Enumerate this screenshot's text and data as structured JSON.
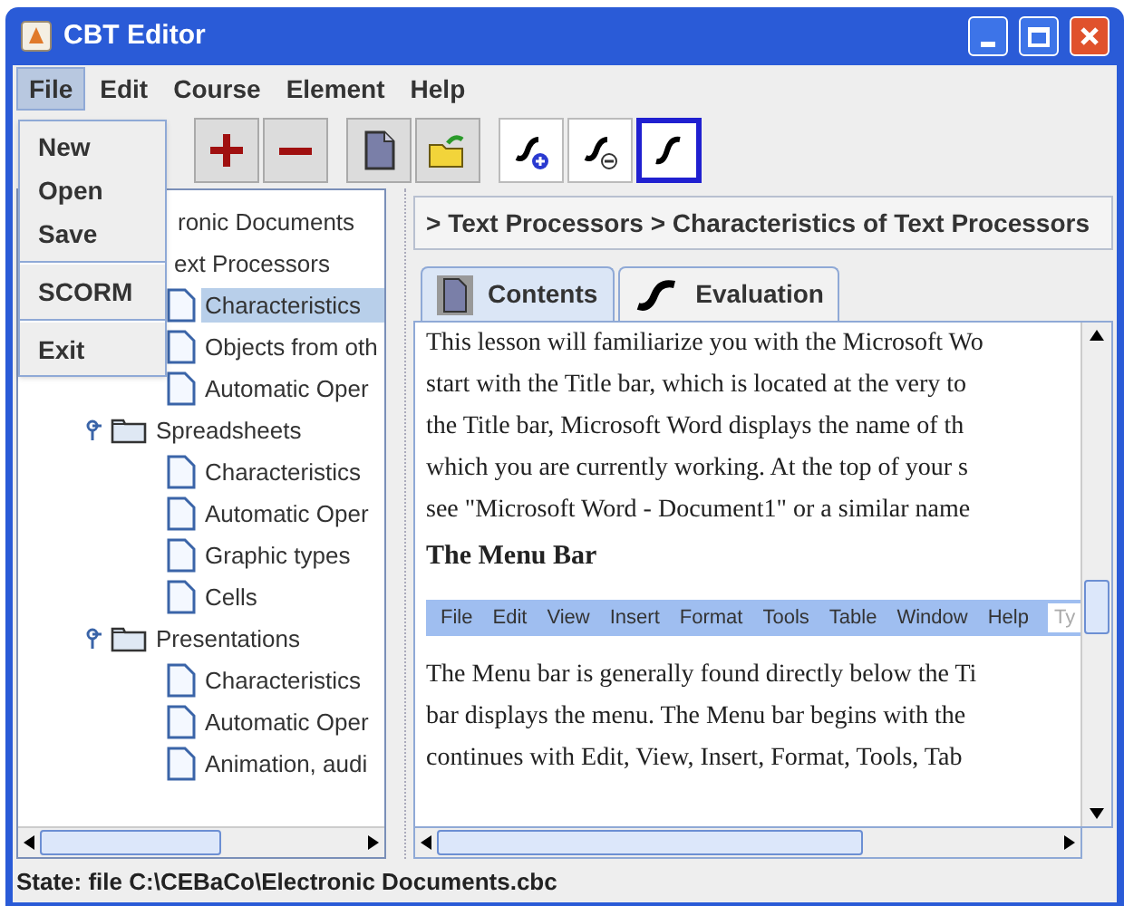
{
  "window": {
    "title": "CBT Editor"
  },
  "menu_bar": [
    {
      "label": "File",
      "selected": true
    },
    {
      "label": "Edit",
      "selected": false
    },
    {
      "label": "Course",
      "selected": false
    },
    {
      "label": "Element",
      "selected": false
    },
    {
      "label": "Help",
      "selected": false
    }
  ],
  "file_menu": [
    {
      "kind": "item",
      "label": "New"
    },
    {
      "kind": "item",
      "label": "Open"
    },
    {
      "kind": "item",
      "label": "Save"
    },
    {
      "kind": "separator"
    },
    {
      "kind": "item",
      "label": "SCORM"
    },
    {
      "kind": "separator"
    },
    {
      "kind": "item",
      "label": "Exit"
    }
  ],
  "toolbar": [
    {
      "kind": "add",
      "selected": false
    },
    {
      "kind": "remove",
      "selected": false
    },
    {
      "kind": "page",
      "selected": false
    },
    {
      "kind": "open",
      "selected": false
    },
    {
      "kind": "eval-add",
      "selected": false
    },
    {
      "kind": "eval-remove",
      "selected": false
    },
    {
      "kind": "eval",
      "selected": true
    }
  ],
  "tree": [
    {
      "kind": "clipped",
      "label": "ronic Documents",
      "selected": false,
      "children": [
        {
          "kind": "clipped",
          "label": "ext Processors",
          "selected": false,
          "children": [
            {
              "kind": "page",
              "label": "Characteristics",
              "selected": true
            },
            {
              "kind": "page",
              "label": "Objects from oth",
              "selected": false
            },
            {
              "kind": "page",
              "label": "Automatic Oper",
              "selected": false
            }
          ]
        },
        {
          "kind": "folder",
          "label": "Spreadsheets",
          "selected": false,
          "children": [
            {
              "kind": "page",
              "label": "Characteristics",
              "selected": false
            },
            {
              "kind": "page",
              "label": "Automatic Oper",
              "selected": false
            },
            {
              "kind": "page",
              "label": "Graphic types",
              "selected": false
            },
            {
              "kind": "page",
              "label": "Cells",
              "selected": false
            }
          ]
        },
        {
          "kind": "folder",
          "label": "Presentations",
          "selected": false,
          "children": [
            {
              "kind": "page",
              "label": "Characteristics",
              "selected": false
            },
            {
              "kind": "page",
              "label": "Automatic Oper",
              "selected": false
            },
            {
              "kind": "page",
              "label": "Animation, audi",
              "selected": false
            }
          ]
        }
      ]
    }
  ],
  "breadcrumb": "> Text Processors > Characteristics of Text Processors",
  "tabs": [
    {
      "kind": "contents",
      "label": "Contents",
      "selected": true
    },
    {
      "kind": "evaluation",
      "label": "Evaluation",
      "selected": false
    }
  ],
  "content": [
    {
      "kind": "line",
      "text": "This lesson will familiarize you with the Microsoft Wo"
    },
    {
      "kind": "line",
      "text": "start with the Title bar, which is located at the very to"
    },
    {
      "kind": "line",
      "text": "the Title bar, Microsoft Word displays the name of th"
    },
    {
      "kind": "line",
      "text": "which you are currently working. At the top of your s"
    },
    {
      "kind": "line",
      "text": "see \"Microsoft Word - Document1\" or a similar name"
    },
    {
      "kind": "heading",
      "text": "The Menu Bar"
    },
    {
      "kind": "menu_image",
      "items": [
        "File",
        "Edit",
        "View",
        "Insert",
        "Format",
        "Tools",
        "Table",
        "Window",
        "Help"
      ],
      "box": "Ty"
    },
    {
      "kind": "line",
      "text": "The Menu bar is generally found directly below the Ti"
    },
    {
      "kind": "line",
      "text": "bar displays the menu. The Menu bar begins with the"
    },
    {
      "kind": "line",
      "text": "continues with Edit, View, Insert, Format, Tools, Tab"
    }
  ],
  "status_bar": "State: file C:\\CEBaCo\\Electronic Documents.cbc"
}
